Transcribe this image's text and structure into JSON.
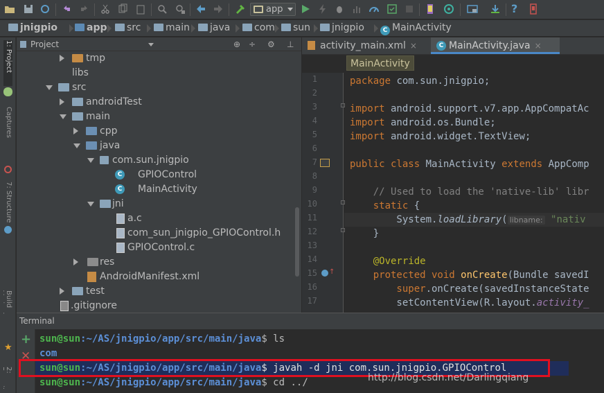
{
  "toolbar": {
    "run_config": "app",
    "icons": [
      "open-icon",
      "save-icon",
      "sync-icon",
      "undo-icon",
      "redo-icon",
      "cut-icon",
      "copy-icon",
      "paste-icon",
      "find-icon",
      "replace-icon",
      "back-icon",
      "forward-icon",
      "build-icon",
      "run-icon",
      "lightning-icon",
      "debug-icon",
      "profile-icon",
      "monitor-icon",
      "coverage-icon",
      "stop-icon",
      "avd-icon",
      "sdk-icon",
      "android-monitor-icon",
      "project-structure-icon",
      "sdk-manager-icon",
      "help-icon",
      "device-icon"
    ]
  },
  "breadcrumb": [
    "jnigpio",
    "app",
    "src",
    "main",
    "java",
    "com",
    "sun",
    "jnigpio",
    "MainActivity"
  ],
  "left_strip": {
    "tabs": [
      "1: Project",
      "Captures",
      "7: Structure",
      "Build Variants",
      "2: Favorites"
    ]
  },
  "project_panel": {
    "title": "Project",
    "tree": [
      {
        "label": "tmp",
        "icon": "folder-icon",
        "expanded": false
      },
      {
        "label": "libs",
        "icon": "none",
        "expanded": null
      },
      {
        "label": "src",
        "icon": "folder-icon",
        "expanded": true
      },
      {
        "label": "androidTest",
        "icon": "folder-icon",
        "expanded": false
      },
      {
        "label": "main",
        "icon": "folder-icon",
        "expanded": true
      },
      {
        "label": "cpp",
        "icon": "folder-icon",
        "expanded": false
      },
      {
        "label": "java",
        "icon": "folder-icon",
        "expanded": true
      },
      {
        "label": "com.sun.jnigpio",
        "icon": "package-icon",
        "expanded": true
      },
      {
        "label": "GPIOControl",
        "icon": "class-icon",
        "expanded": null
      },
      {
        "label": "MainActivity",
        "icon": "class-icon",
        "expanded": null
      },
      {
        "label": "jni",
        "icon": "folder-icon",
        "expanded": true
      },
      {
        "label": "a.c",
        "icon": "c-file-icon",
        "expanded": null
      },
      {
        "label": "com_sun_jnigpio_GPIOControl.h",
        "icon": "h-file-icon",
        "expanded": null
      },
      {
        "label": "GPIOControl.c",
        "icon": "c-file-icon",
        "expanded": null
      },
      {
        "label": "res",
        "icon": "folder-icon",
        "expanded": false
      },
      {
        "label": "AndroidManifest.xml",
        "icon": "xml-file-icon",
        "expanded": null
      },
      {
        "label": "test",
        "icon": "folder-icon",
        "expanded": false
      },
      {
        "label": ".gitignore",
        "icon": "file-icon",
        "expanded": null
      }
    ]
  },
  "editor": {
    "tabs": [
      {
        "label": "activity_main.xml",
        "active": false
      },
      {
        "label": "MainActivity.java",
        "active": true
      }
    ],
    "class_breadcrumb": "MainActivity",
    "line_numbers": [
      "1",
      "2",
      "3",
      "4",
      "5",
      "6",
      "7",
      "8",
      "9",
      "10",
      "11",
      "12",
      "13",
      "14",
      "15",
      "16",
      "17"
    ],
    "code": {
      "l1_kw": "package",
      "l1_rest": " com.sun.jnigpio;",
      "l3_kw": "import",
      "l3_rest": " android.support.v7.app.AppCompatAc",
      "l4_kw": "import",
      "l4_rest": " android.os.Bundle;",
      "l5_kw": "import",
      "l5_rest": " android.widget.TextView;",
      "l7_kw": "public class",
      "l7_mid": " MainActivity ",
      "l7_kw2": "extends",
      "l7_rest": " AppComp",
      "l9_comment": "    // Used to load the 'native-lib' libr",
      "l10_kw": "    static",
      "l10_rest": " {",
      "l11_pre": "        System.",
      "l11_call": "loadLibrary",
      "l11_paren": "(",
      "l11_hint": "libname:",
      "l11_str": " \"nativ",
      "l12": "    }",
      "l14_ann": "    @Override",
      "l15_kw": "    protected void",
      "l15_fn": " onCreate",
      "l15_rest": "(Bundle savedI",
      "l16_kw": "        super",
      "l16_rest": ".onCreate(savedInstanceState",
      "l17_pre": "        setContentView(R.layout.",
      "l17_field": "activity_"
    }
  },
  "terminal": {
    "title": "Terminal",
    "user": "sun@sun",
    "lines": [
      {
        "path": ":~/AS/jnigpio/app/src/main/java",
        "cmd": "$ ls"
      },
      {
        "output": "com"
      },
      {
        "path": ":~/AS/jnigpio/app/src/main/java",
        "cmd": "$ javah -d jni com.sun.jnigpio.GPIOControl"
      },
      {
        "path": ":~/AS/jnigpio/app/src/main/java",
        "cmd": "$ cd ../"
      }
    ],
    "watermark": "http://blog.csdn.net/Darlingqiang"
  },
  "colors": {
    "highlight_box": "#e01020",
    "accent": "#4a88c7"
  }
}
